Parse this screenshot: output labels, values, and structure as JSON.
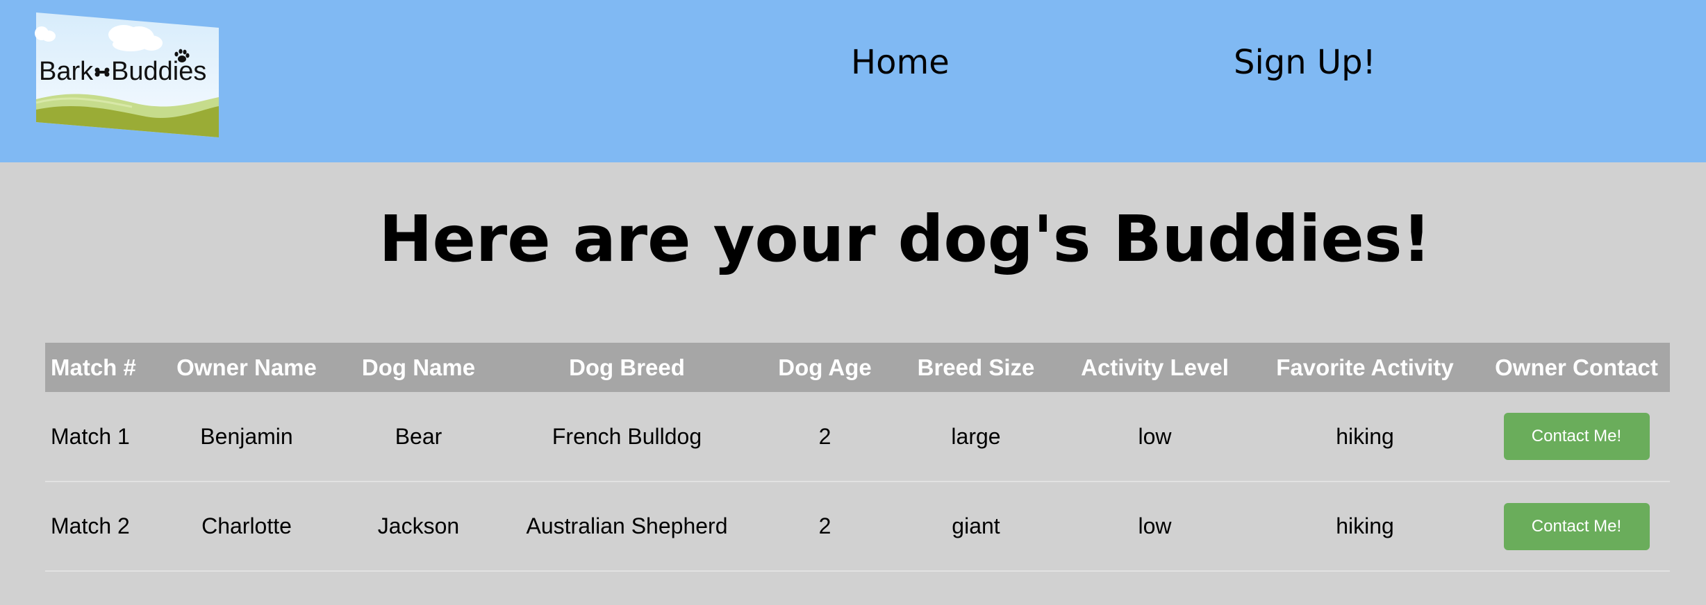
{
  "header": {
    "logo_text_left": "Bark",
    "logo_text_right": "Buddies",
    "nav": [
      {
        "label": "Home"
      },
      {
        "label": "Sign Up!"
      }
    ]
  },
  "page_title": "Here are your dog's Buddies!",
  "table": {
    "columns": [
      "Match #",
      "Owner Name",
      "Dog Name",
      "Dog Breed",
      "Dog Age",
      "Breed Size",
      "Activity Level",
      "Favorite Activity",
      "Owner Contact"
    ],
    "rows": [
      {
        "match": "Match 1",
        "owner": "Benjamin",
        "dog": "Bear",
        "breed": "French Bulldog",
        "age": "2",
        "size": "large",
        "activity_level": "low",
        "favorite_activity": "hiking",
        "contact_label": "Contact Me!"
      },
      {
        "match": "Match 2",
        "owner": "Charlotte",
        "dog": "Jackson",
        "breed": "Australian Shepherd",
        "age": "2",
        "size": "giant",
        "activity_level": "low",
        "favorite_activity": "hiking",
        "contact_label": "Contact Me!"
      }
    ]
  },
  "colors": {
    "header_bg": "#80b9f3",
    "page_bg": "#d1d1d1",
    "table_header_bg": "#a6a6a6",
    "button_bg": "#6aad5b"
  }
}
